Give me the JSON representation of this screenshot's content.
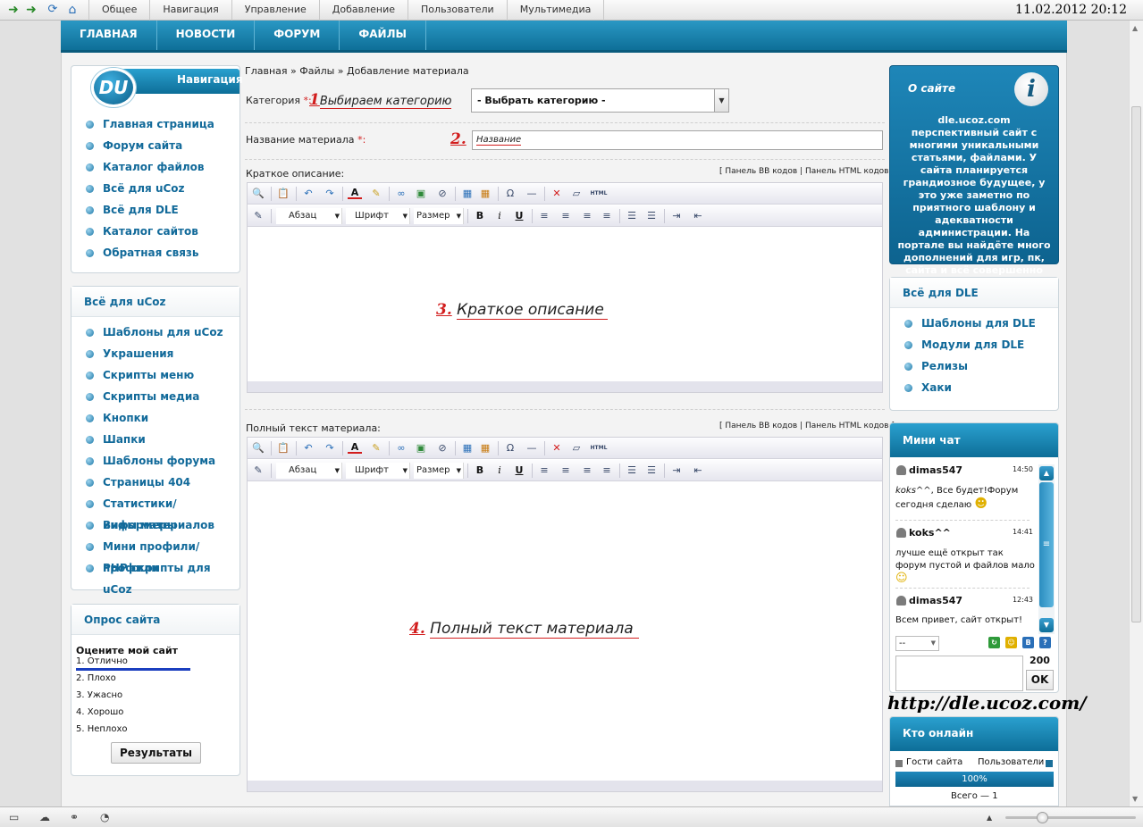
{
  "adminbar": {
    "menu": [
      "Общее",
      "Навигация",
      "Управление",
      "Добавление",
      "Пользователи",
      "Мультимедиа"
    ],
    "clock": "11.02.2012 20:12",
    "icons": [
      "back-arrow-icon",
      "forward-arrow-icon",
      "refresh-icon",
      "home-icon"
    ]
  },
  "topmenu": [
    "ГЛАВНАЯ",
    "НОВОСТИ",
    "ФОРУМ",
    "ФАЙЛЫ"
  ],
  "nav": {
    "logo": "DU",
    "title": "Навигация",
    "items": [
      "Главная страница",
      "Форум сайта",
      "Каталог файлов",
      "Всё для uCoz",
      "Всё для DLE",
      "Каталог сайтов",
      "Обратная связь"
    ]
  },
  "ucoz": {
    "title": "Всё для uCoz",
    "items": [
      "Шаблоны для uCoz",
      "Украшения",
      "Скрипты меню",
      "Скрипты медиа",
      "Кнопки",
      "Шапки",
      "Шаблоны форума",
      "Страницы 404",
      "Статистики/информеры",
      "Виды материалов",
      "Мини профили/профили",
      "PHP скрипты для uCoz"
    ]
  },
  "poll": {
    "title": "Опрос сайта",
    "question": "Оцените мой сайт",
    "options": [
      "1. Отлично",
      "2. Плохо",
      "3. Ужасно",
      "4. Хорошо",
      "5. Неплохо"
    ],
    "results_label": "Результаты"
  },
  "form": {
    "breadcrumb": "Главная » Файлы » Добавление материала",
    "category_label": "Категория",
    "required_mark": "*:",
    "ann1_num": "1",
    "ann1_text": "Выбираем категорию",
    "category_value": "- Выбрать категорию -",
    "title_label": "Название материала",
    "ann2_num": "2.",
    "title_value": "Название",
    "short_label": "Краткое описание:",
    "full_label": "Полный текст материала:",
    "bb_panel": "[ Панель BB кодов",
    "panel_sep": "|",
    "html_panel": "Панель HTML кодов ]",
    "ann3_num": "3.",
    "ann3_text": "Краткое описание",
    "ann4_num": "4.",
    "ann4_text": "Полный текст материала",
    "toolbar": {
      "paragraph": "Абзац",
      "font": "Шрифт",
      "size": "Размер",
      "bold": "B",
      "italic": "i",
      "underline": "U",
      "html": "HTML"
    }
  },
  "about": {
    "title": "О сайте",
    "info_glyph": "i",
    "text": "dle.ucoz.com перспективный сайт с многими уникальными статьями, файлами. У сайта планируется грандиозное будущее, у это уже заметно по приятного шаблону и адекватности администрации. На портале вы найдёте много дополнений для игр, пк, сайта и всё совершенно бесплатно и качественно. Удачи"
  },
  "dle": {
    "title": "Всё для DLE",
    "items": [
      "Шаблоны для DLE",
      "Модули для DLE",
      "Релизы",
      "Хаки"
    ]
  },
  "chat": {
    "title": "Мини чат",
    "messages": [
      {
        "user": "dimas547",
        "time": "14:50",
        "mention": "koks^^",
        "text": ", Все будет!Форум сегодня сделаю"
      },
      {
        "user": "koks^^",
        "time": "14:41",
        "text": "лучше ещё открыт так форум пустой и файлов мало"
      },
      {
        "user": "dimas547",
        "time": "12:43",
        "text": "Всем привет, сайт открыт!"
      }
    ],
    "select_value": "--",
    "counter": "200",
    "ok_label": "OK"
  },
  "site_url": "http://dle.ucoz.com/",
  "online": {
    "title": "Кто онлайн",
    "guests_label": "Гости сайта",
    "users_label": "Пользователи",
    "percent_label": "100%",
    "total": "Всего — 1",
    "colors": {
      "guests": "#7a7a7a",
      "users": "#1a6f9a"
    }
  }
}
